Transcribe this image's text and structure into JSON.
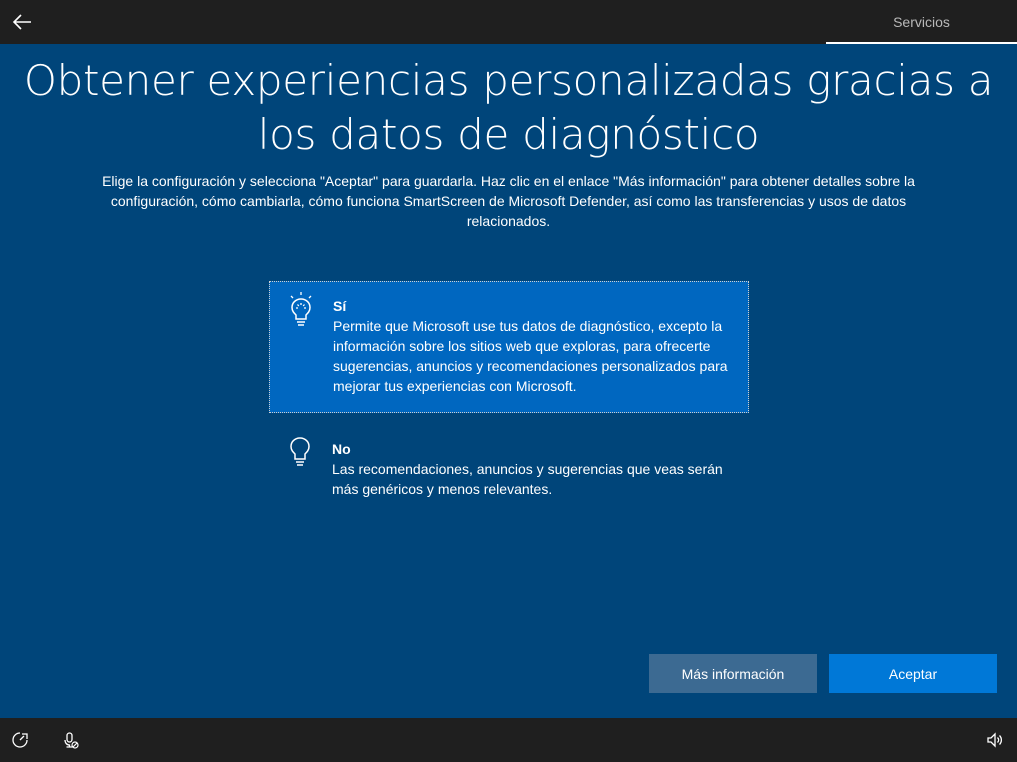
{
  "header": {
    "tab_label": "Servicios"
  },
  "main": {
    "title": "Obtener experiencias personalizadas gracias a los datos de diagnóstico",
    "subtitle": "Elige la configuración y selecciona \"Aceptar\" para guardarla. Haz clic en el enlace \"Más información\" para obtener detalles sobre la configuración, cómo cambiarla, cómo funciona SmartScreen de Microsoft Defender, así como las transferencias y usos de datos relacionados.",
    "options": [
      {
        "title": "Sí",
        "description": "Permite que Microsoft use tus datos de diagnóstico, excepto la información sobre los sitios web que exploras, para ofrecerte sugerencias, anuncios y recomendaciones personalizados para mejorar tus experiencias con Microsoft.",
        "selected": true,
        "icon": "lightbulb-on-icon"
      },
      {
        "title": "No",
        "description": "Las recomendaciones, anuncios y sugerencias que veas serán más genéricos y menos relevantes.",
        "selected": false,
        "icon": "lightbulb-off-icon"
      }
    ]
  },
  "buttons": {
    "more_info_label": "Más información",
    "accept_label": "Aceptar"
  },
  "icons": {
    "back": "back-arrow-icon",
    "accessibility": "accessibility-icon",
    "microphone": "microphone-muted-icon",
    "volume": "volume-icon"
  },
  "colors": {
    "background": "#00457a",
    "selected_option": "#0067c0",
    "accept_button": "#0078d7",
    "secondary_button": "#3c6a92",
    "bar": "#1f1f1f"
  }
}
